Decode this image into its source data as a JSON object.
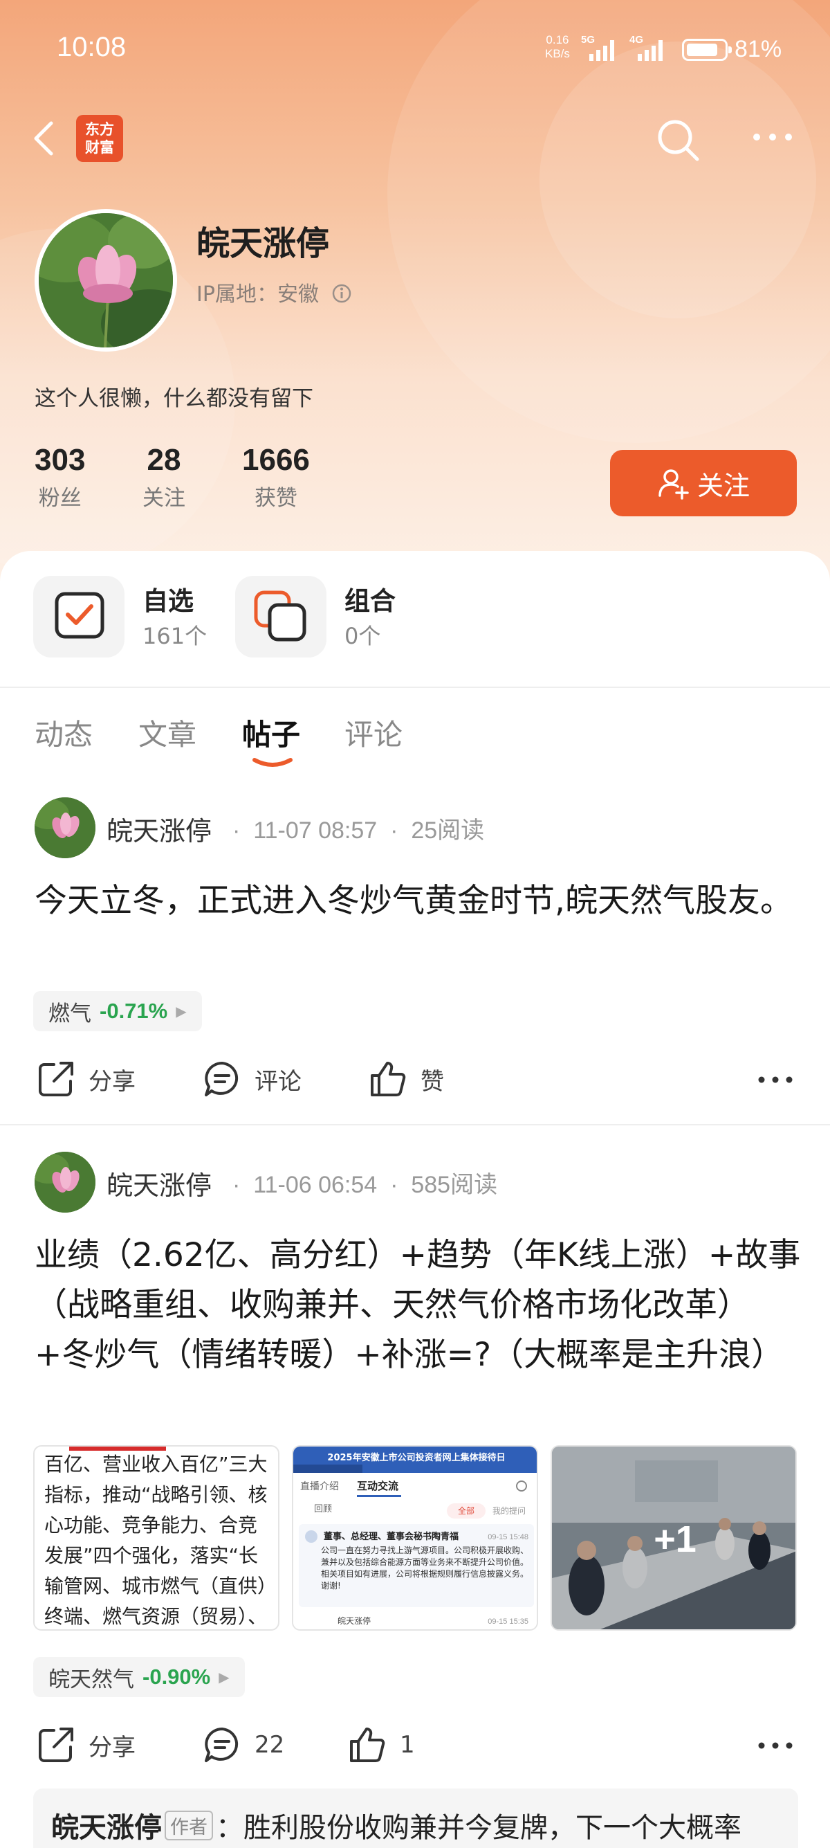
{
  "status_bar": {
    "time": "10:08",
    "net_speed_value": "0.16",
    "net_speed_unit": "KB/s",
    "signal1": "5G",
    "signal2": "4G",
    "battery": "81%"
  },
  "header": {
    "logo_line1": "东方",
    "logo_line2": "财富"
  },
  "profile": {
    "name": "皖天涨停",
    "ip_location": "IP属地：安徽",
    "bio": "这个人很懒，什么都没有留下",
    "stats": [
      {
        "value": "303",
        "label": "粉丝"
      },
      {
        "value": "28",
        "label": "关注"
      },
      {
        "value": "1666",
        "label": "获赞"
      }
    ],
    "follow_label": "关注"
  },
  "tiles": [
    {
      "title": "自选",
      "sub": "161个",
      "icon": "checkbox-icon"
    },
    {
      "title": "组合",
      "sub": "0个",
      "icon": "portfolio-icon"
    }
  ],
  "tabs": [
    "动态",
    "文章",
    "帖子",
    "评论"
  ],
  "active_tab": "帖子",
  "posts": [
    {
      "author": "皖天涨停",
      "date": "11-07 08:57",
      "reads": "25阅读",
      "text": "今天立冬，正式进入冬炒气黄金时节,皖天然气股友。",
      "stock_name": "燃气",
      "stock_change": "-0.71%",
      "share_label": "分享",
      "comment_label": "评论",
      "like_label": "赞"
    },
    {
      "author": "皖天涨停",
      "date": "11-06 06:54",
      "reads": "585阅读",
      "text": "业绩（2.62亿、高分红）+趋势（年K线上涨）+故事（战略重组、收购兼并、天然气价格市场化改革）+冬炒气（情绪转暖）+补涨=?（大概率是主升浪）",
      "image1_text": "百亿、营业收入百亿”三大指标，推动“战略引领、核心功能、竞争能力、合竞发展”四个强化，落实“长输管网、城市燃气（直供）终端、燃气资源（贸易）、综合",
      "image2_banner": "2025年安徽上市公司投资者网上集体接待日",
      "image2_tab1": "直播介绍",
      "image2_tab2": "互动交流",
      "image2_reply": "回顾",
      "image2_chip1": "全部",
      "image2_chip2": "我的提问",
      "image2_title": "董事、总经理、董事会秘书陶青福",
      "image2_time": "09-15 15:48",
      "image2_body": "公司一直在努力寻找上游气源项目。公司积极开展收购、兼并以及包括综合能源方面等业务来不断提升公司价值。相关项目如有进展，公司将根据规则履行信息披露义务。谢谢!",
      "image2_user": "皖天涨停",
      "image2_user_time": "09-15 15:35",
      "image3_more": "+1",
      "stock_name": "皖天然气",
      "stock_change": "-0.90%",
      "share_label": "分享",
      "comment_count": "22",
      "like_count": "1"
    }
  ],
  "comment_preview": {
    "name": "皖天涨停",
    "tag": "作者",
    "text": "：胜利股份收购兼并今复牌，下一个大概率"
  },
  "colors": {
    "accent": "#ec5b2b",
    "down_green": "#2aa44f"
  }
}
